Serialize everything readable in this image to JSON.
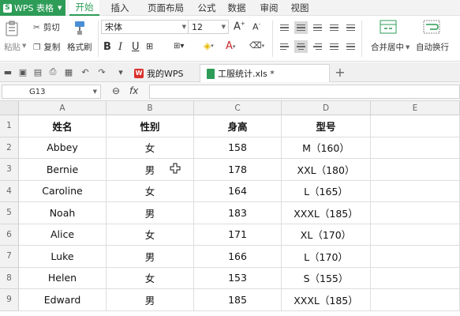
{
  "app": {
    "name": "WPS 表格",
    "logo": "S"
  },
  "menu": [
    "开始",
    "插入",
    "页面布局",
    "公式",
    "数据",
    "审阅",
    "视图"
  ],
  "ribbon": {
    "cut": "剪切",
    "paste": "粘贴",
    "copy": "复制",
    "format_painter": "格式刷",
    "font_name": "宋体",
    "font_size": "12",
    "merge_center": "合并居中",
    "wrap_text": "自动换行"
  },
  "tabs": {
    "my_wps": "我的WPS",
    "file": "工服统计.xls *"
  },
  "formula_bar": {
    "cell_ref": "G13",
    "fx": "fx",
    "value": ""
  },
  "grid": {
    "columns": [
      "A",
      "B",
      "C",
      "D",
      "E"
    ],
    "rows": [
      "1",
      "2",
      "3",
      "4",
      "5",
      "6",
      "7",
      "8",
      "9"
    ],
    "data": [
      [
        "姓名",
        "性别",
        "身高",
        "型号",
        ""
      ],
      [
        "Abbey",
        "女",
        "158",
        "M（160）",
        ""
      ],
      [
        "Bernie",
        "男",
        "178",
        "XXL（180）",
        ""
      ],
      [
        "Caroline",
        "女",
        "164",
        "L（165）",
        ""
      ],
      [
        "Noah",
        "男",
        "183",
        "XXXL（185）",
        ""
      ],
      [
        "Alice",
        "女",
        "171",
        "XL（170）",
        ""
      ],
      [
        "Luke",
        "男",
        "166",
        "L（170）",
        ""
      ],
      [
        "Helen",
        "女",
        "153",
        "S（155）",
        ""
      ],
      [
        "Edward",
        "男",
        "185",
        "XXXL（185）",
        ""
      ]
    ]
  },
  "colors": {
    "accent": "#2d9c57",
    "wps_red": "#d9312b"
  }
}
